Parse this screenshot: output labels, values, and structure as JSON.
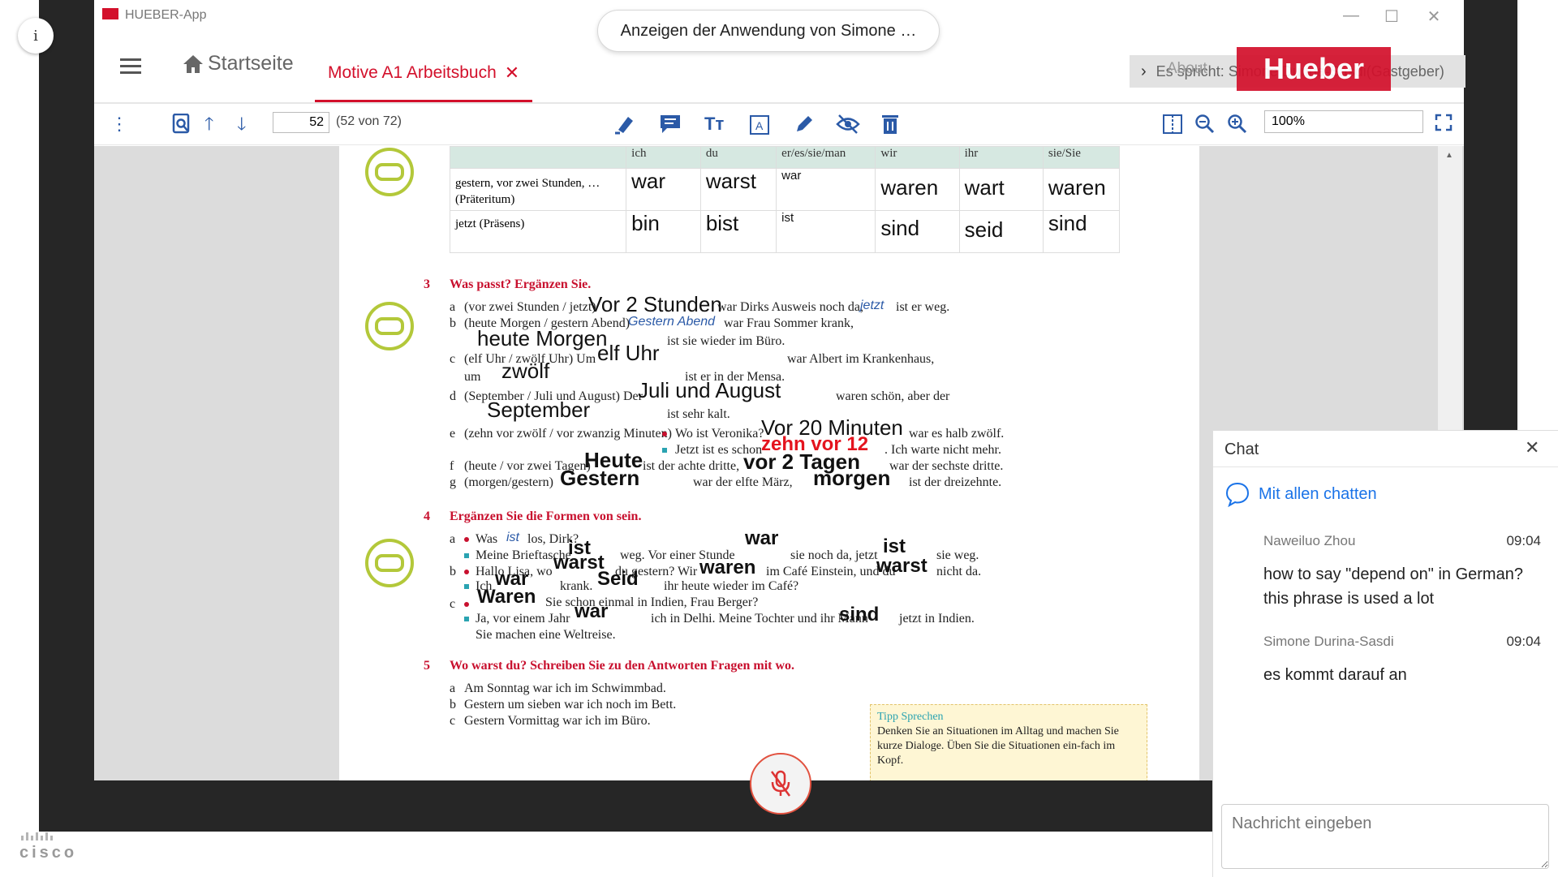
{
  "meeting": {
    "share_banner": "Anzeigen der Anwendung von Simone …",
    "cisco_logo": "cisco"
  },
  "app": {
    "title": "HUEBER-App",
    "nav": {
      "home_label": "Startseite",
      "doc_tab_label": "Motive A1 Arbeitsbuch",
      "about_label": "About",
      "speaker_label": "Es spricht: Simone Durina-Sasdi(Gastgeber)",
      "brand_logo": "Hueber"
    },
    "toolbar": {
      "page_number": "52",
      "page_total": "(52 von 72)",
      "zoom": "100%"
    }
  },
  "worksheet": {
    "table": {
      "headers": [
        "",
        "ich",
        "du",
        "er/es/sie/man",
        "wir",
        "ihr",
        "sie/Sie"
      ],
      "rows": [
        {
          "label": "gestern, vor zwei Stunden, … (Präteritum)",
          "ich": "war",
          "du": "warst",
          "er": "war",
          "wir": "waren",
          "ihr": "wart",
          "sie": "waren"
        },
        {
          "label": "jetzt (Präsens)",
          "ich": "bin",
          "du": "bist",
          "er": "ist",
          "wir": "sind",
          "ihr": "seid",
          "sie": "sind"
        }
      ]
    },
    "ex3": {
      "number": "3",
      "title": "Was passt? Ergänzen Sie.",
      "a_letter": "a",
      "a_hint": "(vor zwei Stunden / jetzt)",
      "a_answer1": "Vor 2 Stunden",
      "a_text": "war Dirks Ausweis noch da,",
      "a_answer2": "jetzt",
      "a_text2": "ist er weg.",
      "b_letter": "b",
      "b_hint": "(heute Morgen / gestern Abend)",
      "b_answer1": "Gestern Abend",
      "b_text": "war Frau Sommer krank,",
      "b_answer2": "heute Morgen",
      "b_text2": "ist sie wieder im Büro.",
      "c_letter": "c",
      "c_hint": "(elf Uhr / zwölf Uhr) Um",
      "c_answer1": "elf Uhr",
      "c_text": "war Albert im Krankenhaus,",
      "c_um": "um",
      "c_answer2": "zwölf",
      "c_text2": "ist er in der Mensa.",
      "d_letter": "d",
      "d_hint": "(September / Juli und August) Der",
      "d_answer1": "Juli und August",
      "d_text": "waren schön, aber der",
      "d_answer2": "September",
      "d_text2": "ist sehr kalt.",
      "e_letter": "e",
      "e_hint": "(zehn vor zwölf / vor zwanzig Minuten)",
      "e_q": "Wo ist Veronika?",
      "e_answer1": "Vor 20 Minuten",
      "e_text": "war es halb zwölf.",
      "e_q2": "Jetzt ist es schon",
      "e_answer2": "zehn vor 12",
      "e_text2": ". Ich warte nicht mehr.",
      "f_letter": "f",
      "f_hint": "(heute / vor zwei Tagen)",
      "f_answer1": "Heute",
      "f_text": "ist der achte dritte,",
      "f_answer2": "vor 2 Tagen",
      "f_text2": "war der sechste dritte.",
      "g_letter": "g",
      "g_hint": "(morgen/gestern)",
      "g_answer1": "Gestern",
      "g_text": "war der elfte März,",
      "g_answer2": "morgen",
      "g_text2": "ist der dreizehnte."
    },
    "ex4": {
      "number": "4",
      "title": "Ergänzen Sie die Formen von sein.",
      "a_letter": "a",
      "a1": "Was",
      "a1_ans": "ist",
      "a1_rest": "los, Dirk?",
      "a2": "Meine Brieftasche",
      "a2_ans": "ist",
      "a2_mid": "weg. Vor einer Stunde",
      "a2_ans2": "war",
      "a2_mid2": "sie noch da, jetzt",
      "a2_ans3": "ist",
      "a2_rest": "sie weg.",
      "b_letter": "b",
      "b1": "Hallo Lisa, wo",
      "b1_ans": "warst",
      "b1_mid": "du gestern? Wir",
      "b1_ans2": "waren",
      "b1_mid2": "im Café Einstein, und du",
      "b1_ans3": "warst",
      "b1_rest": "nicht da.",
      "b2": "Ich",
      "b2_ans": "war",
      "b2_mid": "krank.",
      "b2_ans2": "Seid",
      "b2_rest": "ihr heute wieder im Café?",
      "c_letter": "c",
      "c1_ans": "Waren",
      "c1_rest": "Sie schon einmal in Indien, Frau Berger?",
      "c2": "Ja, vor einem Jahr",
      "c2_ans": "war",
      "c2_mid": "ich in Delhi. Meine Tochter und ihr Mann",
      "c2_ans2": "sind",
      "c2_rest": "jetzt in Indien.",
      "c3": "Sie machen eine Weltreise."
    },
    "ex5": {
      "number": "5",
      "title": "Wo warst du? Schreiben Sie zu den Antworten Fragen mit wo.",
      "a_letter": "a",
      "a": "Am Sonntag war ich im Schwimmbad.",
      "b_letter": "b",
      "b": "Gestern um sieben war ich noch im Bett.",
      "c_letter": "c",
      "c": "Gestern Vormittag war ich im Büro."
    },
    "tip": {
      "title": "Tipp Sprechen",
      "text": "Denken Sie an Situationen im Alltag und machen Sie kurze Dialoge. Üben Sie die Situationen ein-fach im Kopf."
    }
  },
  "chat": {
    "title": "Chat",
    "channel": "Mit allen chatten",
    "messages": [
      {
        "sender": "Naweiluo Zhou",
        "time": "09:04",
        "text": "how to say \"depend on\" in German? this phrase is used a lot"
      },
      {
        "sender": "Simone Durina-Sasdi",
        "time": "09:04",
        "text": "es kommt darauf an"
      }
    ],
    "input_placeholder": "Nachricht eingeben"
  },
  "colors": {
    "brand_red": "#d3102b",
    "link_blue": "#1a73e8",
    "toolbar_blue": "#2b5aa7",
    "ring_green": "#b3c83a",
    "mic_border": "#e25240"
  },
  "icons": [
    "info-icon",
    "hamburger-icon",
    "home-icon",
    "close-icon",
    "chevron-right-icon",
    "search-page-icon",
    "arrow-up-icon",
    "arrow-down-icon",
    "highlight-icon",
    "comment-icon",
    "text-size-icon",
    "text-frame-icon",
    "pencil-icon",
    "eye-off-icon",
    "trash-icon",
    "split-view-icon",
    "zoom-out-icon",
    "zoom-in-icon",
    "fullscreen-icon",
    "mic-off-icon",
    "chat-bubble-icon",
    "link-icon"
  ]
}
